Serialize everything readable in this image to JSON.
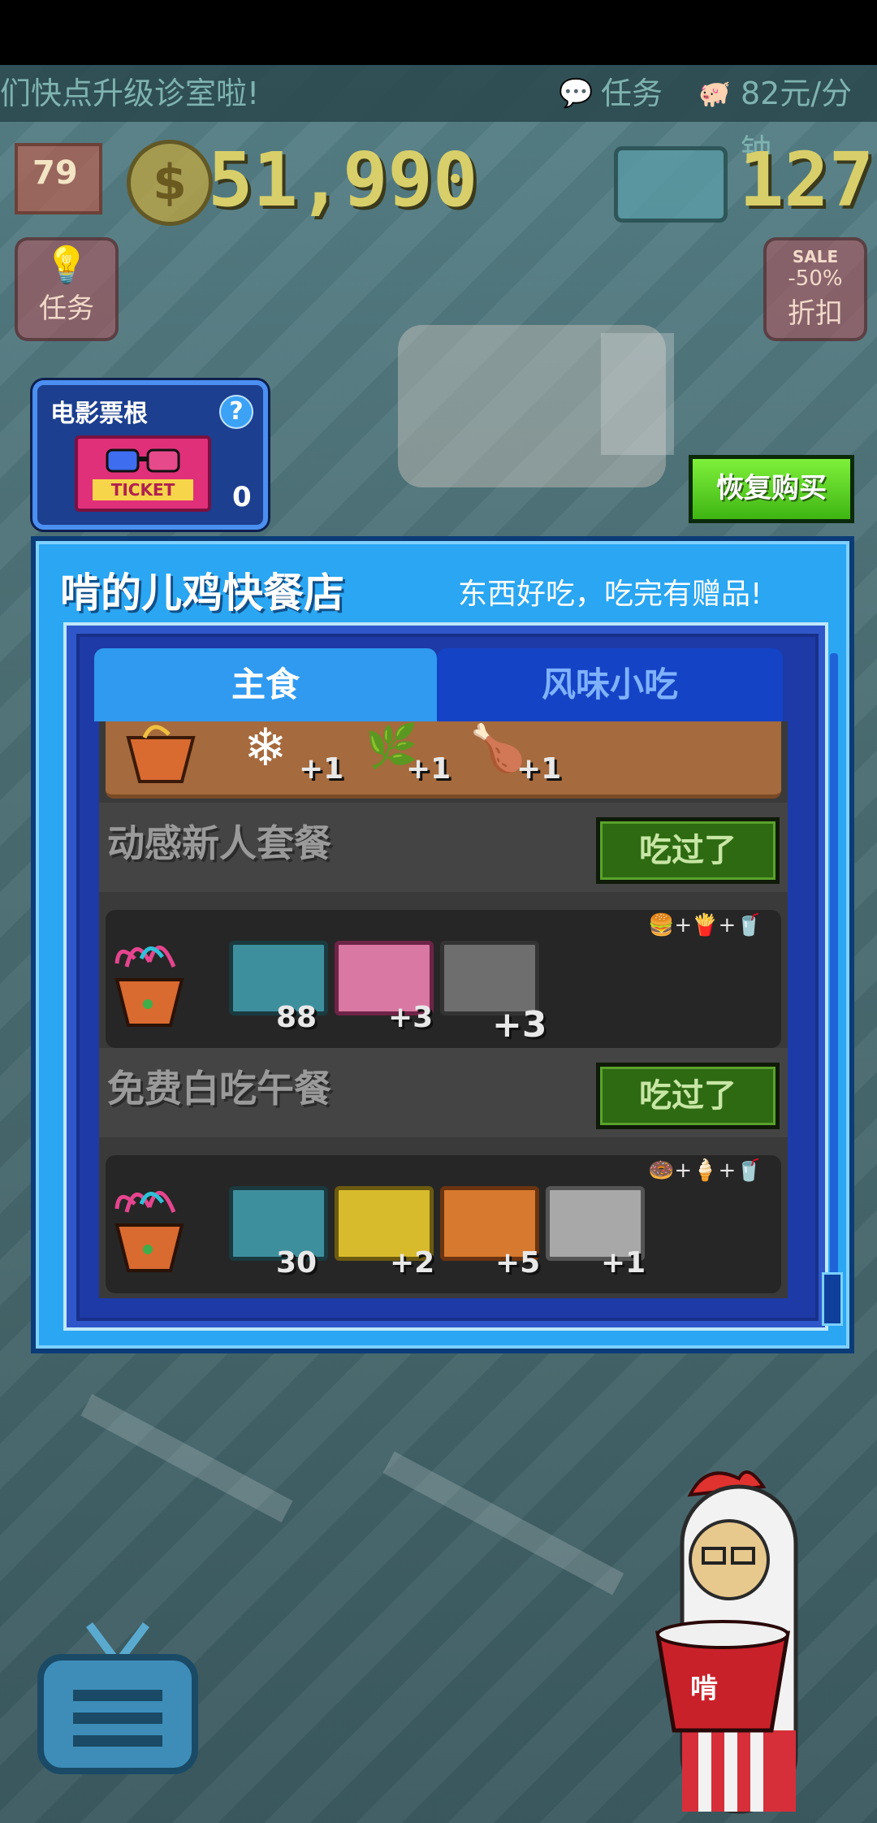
{
  "top_strip": {
    "marquee": "们快点升级诊室啦!",
    "task_label": "任务",
    "income_rate": "82元/分钟"
  },
  "hud": {
    "level": "79",
    "coins": "51,990",
    "fish": "127",
    "task_button": "任务",
    "discount_button": "折扣",
    "sale_badge": "SALE",
    "sale_pct": "-50%"
  },
  "ticket_widget": {
    "title": "电影票根",
    "help": "?",
    "ticket_label": "TICKET",
    "count": "0"
  },
  "restore_button": "恢复购买",
  "dialog": {
    "title": "啃的儿鸡快餐店",
    "subtitle": "东西好吃，吃完有赠品!",
    "tabs": {
      "main": "主食",
      "snack": "风味小吃"
    },
    "top_strip_counts": [
      "+1",
      "+1",
      "+1"
    ],
    "meals": [
      {
        "name": "动感新人套餐",
        "status": "吃过了",
        "combo": [
          "burger-icon",
          "fries-icon",
          "drink-icon"
        ],
        "rewards": [
          {
            "icon": "fish-card-icon",
            "count": "88"
          },
          {
            "icon": "pink-ticket-icon",
            "count": "+3"
          },
          {
            "icon": "gray-ticket-icon",
            "count": "+3"
          }
        ]
      },
      {
        "name": "免费白吃午餐",
        "status": "吃过了",
        "combo": [
          "donut-icon",
          "ice-cream-icon",
          "drink-icon"
        ],
        "rewards": [
          {
            "icon": "fish-card-icon",
            "count": "30"
          },
          {
            "icon": "yellow-ticket-icon",
            "count": "+2"
          },
          {
            "icon": "orange-ticket-icon",
            "count": "+5"
          },
          {
            "icon": "silver-ticket-icon",
            "count": "+1"
          }
        ]
      }
    ]
  },
  "colors": {
    "dialog_bg": "#2aa6f2",
    "tab_active": "#2f9af0",
    "tab_inactive": "#1443c5",
    "ate_button": "#2e6a12",
    "restore_button": "#5cd726"
  }
}
